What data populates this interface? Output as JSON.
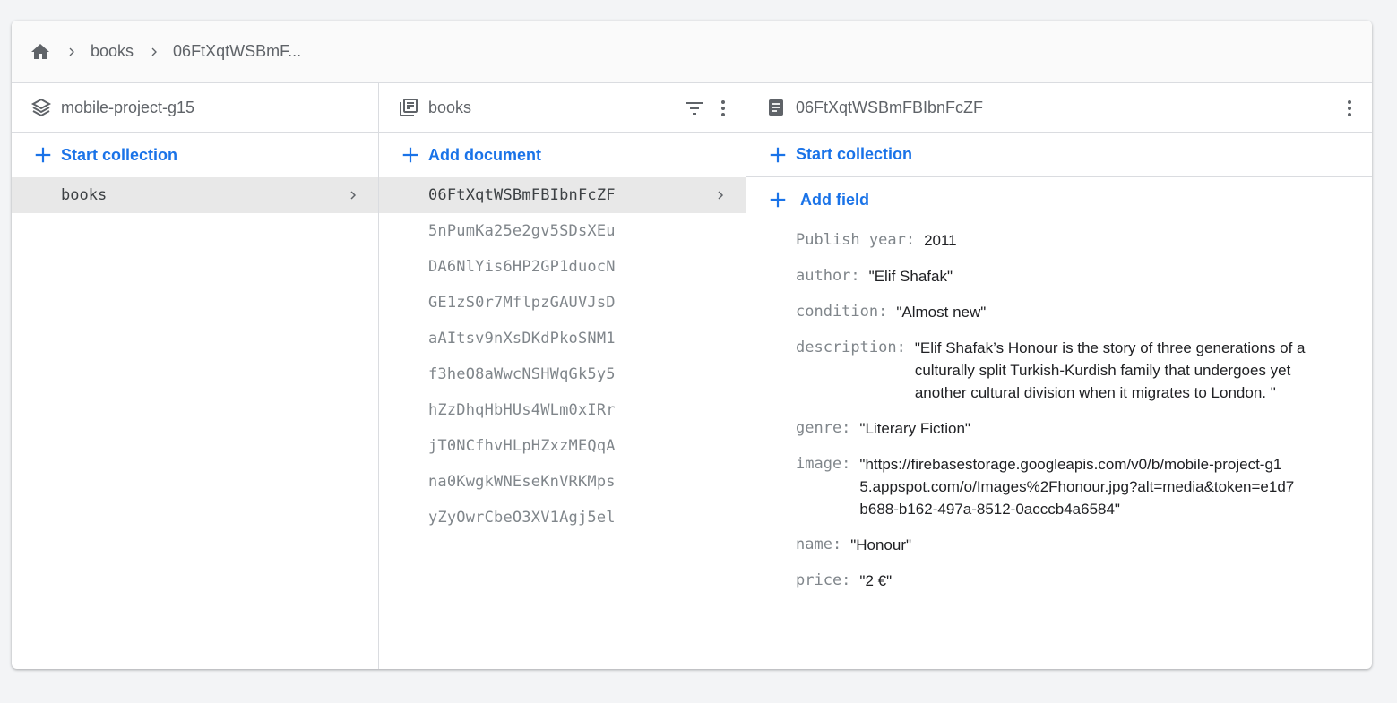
{
  "breadcrumb": {
    "home_icon": "home-icon",
    "items": [
      "books",
      "06FtXqtWSBmF..."
    ]
  },
  "project_panel": {
    "icon": "firestore-stack-icon",
    "title": "mobile-project-g15",
    "add_label": "Start collection",
    "collections": [
      "books"
    ]
  },
  "collection_panel": {
    "icon": "collection-icon",
    "title": "books",
    "add_label": "Add document",
    "documents": [
      "06FtXqtWSBmFBIbnFcZF",
      "5nPumKa25e2gv5SDsXEu",
      "DA6NlYis6HP2GP1duocN",
      "GE1zS0r7MflpzGAUVJsD",
      "aAItsv9nXsDKdPkoSNM1",
      "f3heO8aWwcNSHWqGk5y5",
      "hZzDhqHbHUs4WLm0xIRr",
      "jT0NCfhvHLpHZxzMEQqA",
      "na0KwgkWNEseKnVRKMps",
      "yZyOwrCbeO3XV1Agj5el"
    ]
  },
  "document_panel": {
    "icon": "document-icon",
    "title": "06FtXqtWSBmFBIbnFcZF",
    "start_collection_label": "Start collection",
    "add_field_label": "Add field",
    "fields": [
      {
        "key": "Publish year:",
        "value": "2011"
      },
      {
        "key": "author:",
        "value": "\"Elif Shafak\""
      },
      {
        "key": "condition:",
        "value": "\"Almost new\""
      },
      {
        "key": "description:",
        "value": "\"Elif Shafak’s Honour is the story of three generations of a culturally split Turkish-Kurdish family that undergoes yet another cultural division when it migrates to London. \""
      },
      {
        "key": "genre:",
        "value": "\"Literary Fiction\""
      },
      {
        "key": "image:",
        "value": "\"https://firebasestorage.googleapis.com/v0/b/mobile-project-g15.appspot.com/o/Images%2Fhonour.jpg?alt=media&token=e1d7b688-b162-497a-8512-0acccb4a6584\""
      },
      {
        "key": "name:",
        "value": "\"Honour\""
      },
      {
        "key": "price:",
        "value": "\"2 €\""
      }
    ]
  },
  "colors": {
    "accent": "#1a73e8",
    "selected_row": "#e8e8e8",
    "border": "#dadce0",
    "muted_text": "#5f6368"
  }
}
